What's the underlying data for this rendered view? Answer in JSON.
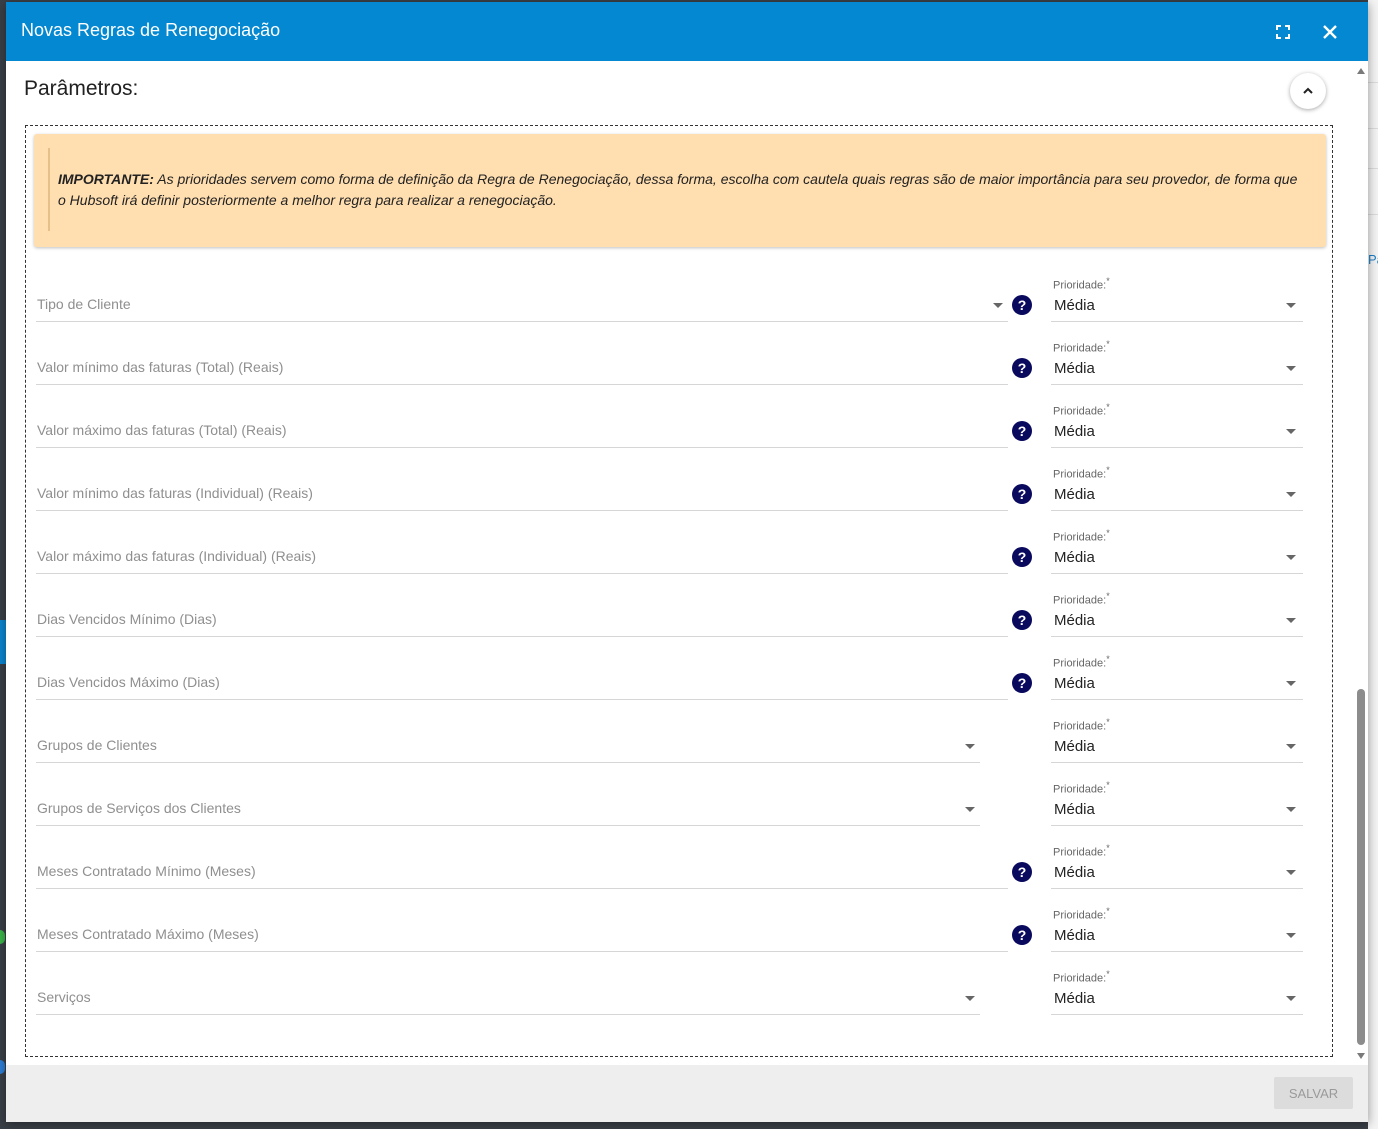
{
  "dialog": {
    "title": "Novas Regras de Renegociação",
    "fullscreen_icon": "fullscreen-icon",
    "close_icon": "close-icon"
  },
  "section": {
    "title": "Parâmetros:"
  },
  "alert": {
    "strong": "IMPORTANTE:",
    "text": " As prioridades servem como forma de definição da Regra de Renegociação, dessa forma, escolha com cautela quais regras são de maior importância para seu provedor, de forma que o Hubsoft irá definir posteriormente a melhor regra para realizar a renegociação."
  },
  "priority_label": "Prioridade:",
  "required_mark": "*",
  "fields": [
    {
      "label": "Tipo de Cliente",
      "kind": "select-help",
      "priority": "Média"
    },
    {
      "label": "Valor mínimo das faturas (Total) (Reais)",
      "kind": "input-help",
      "priority": "Média"
    },
    {
      "label": "Valor máximo das faturas (Total) (Reais)",
      "kind": "input-help",
      "priority": "Média"
    },
    {
      "label": "Valor mínimo das faturas (Individual) (Reais)",
      "kind": "input-help",
      "priority": "Média"
    },
    {
      "label": "Valor máximo das faturas (Individual) (Reais)",
      "kind": "input-help",
      "priority": "Média"
    },
    {
      "label": "Dias Vencidos Mínimo (Dias)",
      "kind": "input-help",
      "priority": "Média"
    },
    {
      "label": "Dias Vencidos Máximo (Dias)",
      "kind": "input-help",
      "priority": "Média"
    },
    {
      "label": "Grupos de Clientes",
      "kind": "select",
      "priority": "Média"
    },
    {
      "label": "Grupos de Serviços dos Clientes",
      "kind": "select",
      "priority": "Média"
    },
    {
      "label": "Meses Contratado Mínimo (Meses)",
      "kind": "input-help",
      "priority": "Média"
    },
    {
      "label": "Meses Contratado Máximo (Meses)",
      "kind": "input-help",
      "priority": "Média"
    },
    {
      "label": "Serviços",
      "kind": "select",
      "priority": "Média"
    }
  ],
  "help_glyph": "?",
  "footer": {
    "save_label": "SALVAR"
  },
  "background": {
    "link_fragment": "Pa"
  },
  "colors": {
    "header": "#0388d1",
    "alert_bg": "#ffdeb0",
    "help_icon": "#09095e"
  }
}
